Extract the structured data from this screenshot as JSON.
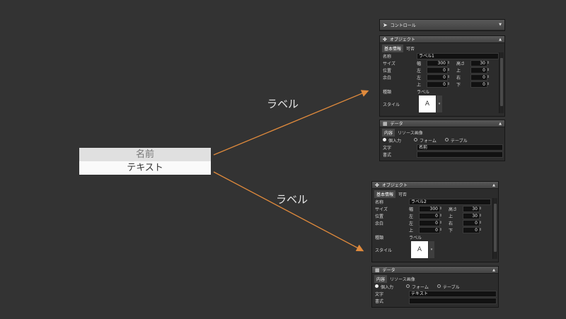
{
  "prototype": {
    "row1": "名前",
    "row2": "テキスト"
  },
  "annotations": {
    "upper": "ラベル",
    "lower": "ラベル"
  },
  "colors": {
    "arrow": "#e08a3c",
    "background": "#333333"
  },
  "control_panel": {
    "title": "コントロール",
    "icon": "cursor-icon"
  },
  "inspector_top": {
    "object_title": "オブジェクト",
    "tabs": [
      "基本情報",
      "可否"
    ],
    "name_label": "名称",
    "name_value": "ラベル1",
    "size_label": "サイズ",
    "width_label": "幅",
    "width_value": "300",
    "height_label": "高さ",
    "height_value": "30",
    "position_label": "位置",
    "left_label": "左",
    "left_value": "0",
    "top_label": "上",
    "top_value": "0",
    "margin_label": "余白",
    "m_left_label": "左",
    "m_left_value": "0",
    "m_right_label": "右",
    "m_right_value": "0",
    "m_top_label": "上",
    "m_top_value": "0",
    "m_bottom_label": "下",
    "m_bottom_value": "0",
    "kind_label": "種類",
    "kind_value": "ラベル",
    "style_label": "スタイル",
    "style_preview": "A",
    "data_title": "データ",
    "data_tabs": [
      "内容",
      "リソース画像"
    ],
    "radio_options": [
      "個入力",
      "フォーム",
      "テーブル"
    ],
    "text_label": "文字",
    "text_value": "名前",
    "format_label": "書式",
    "format_value": ""
  },
  "inspector_bottom": {
    "object_title": "オブジェクト",
    "tabs": [
      "基本情報",
      "可否"
    ],
    "name_label": "名称",
    "name_value": "ラベル2",
    "size_label": "サイズ",
    "width_label": "幅",
    "width_value": "300",
    "height_label": "高さ",
    "height_value": "30",
    "position_label": "位置",
    "left_label": "左",
    "left_value": "0",
    "top_label": "上",
    "top_value": "30",
    "margin_label": "余白",
    "m_left_label": "左",
    "m_left_value": "0",
    "m_right_label": "右",
    "m_right_value": "0",
    "m_top_label": "上",
    "m_top_value": "0",
    "m_bottom_label": "下",
    "m_bottom_value": "0",
    "kind_label": "種類",
    "kind_value": "ラベル",
    "style_label": "スタイル",
    "style_preview": "A",
    "data_title": "データ",
    "data_tabs": [
      "内容",
      "リソース画像"
    ],
    "radio_options": [
      "個入力",
      "フォーム",
      "テーブル"
    ],
    "text_label": "文字",
    "text_value": "テキスト",
    "format_label": "書式",
    "format_value": ""
  }
}
